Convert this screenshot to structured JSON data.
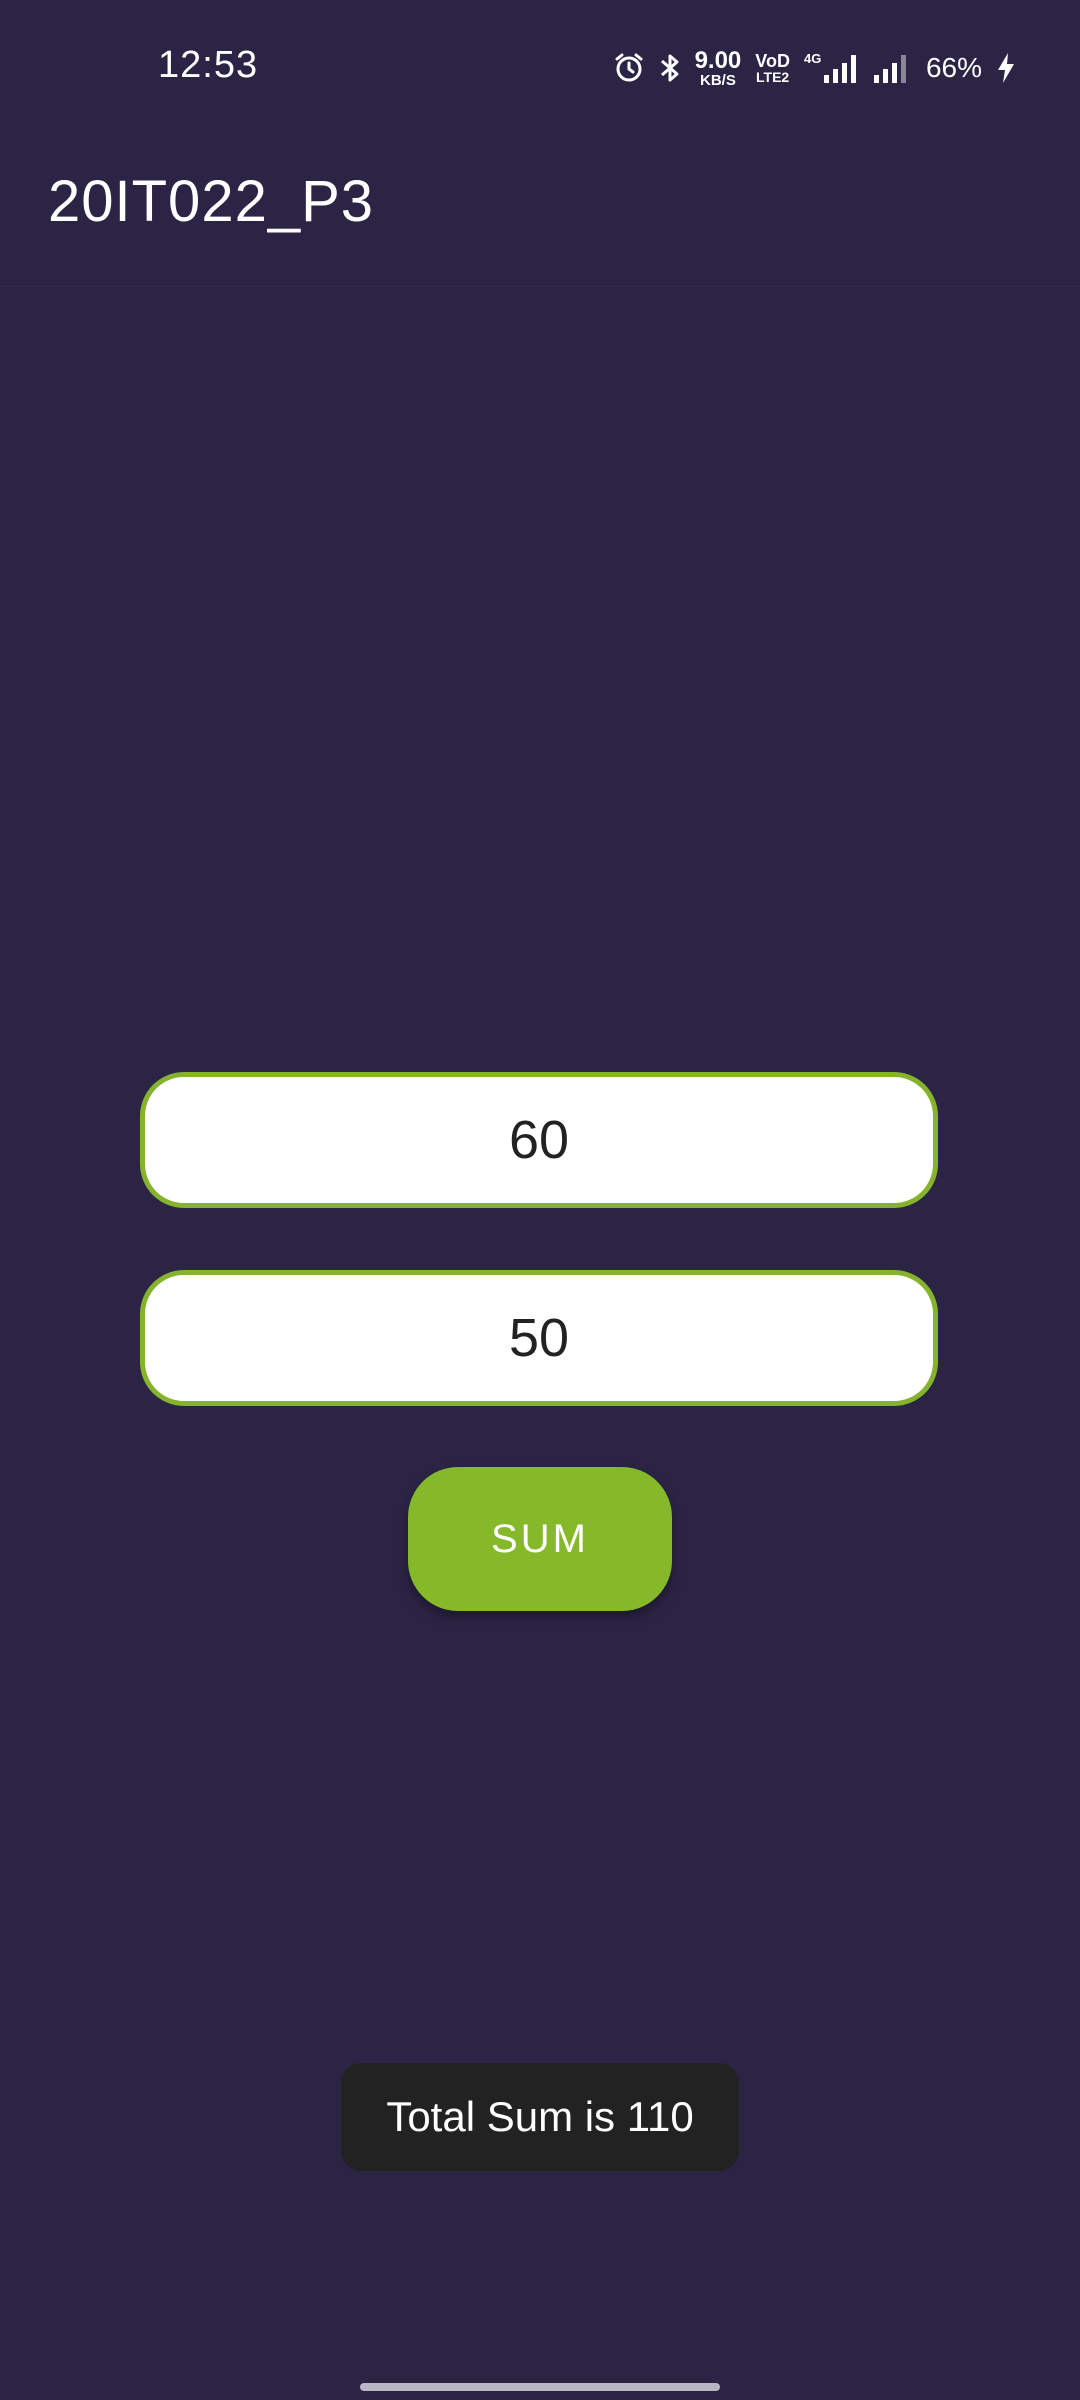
{
  "status_bar": {
    "time": "12:53",
    "icons": [
      "alarm-icon",
      "bluetooth-icon",
      "volte-icon",
      "4g-signal-icon",
      "signal-icon",
      "battery-charging-icon"
    ],
    "net_speed_value": "9.00",
    "net_speed_unit": "KB/S",
    "volte_top": "VoD",
    "volte_bottom": "LTE2",
    "network_type": "4G",
    "battery": "66%"
  },
  "app_bar": {
    "title": "20IT022_P3"
  },
  "form": {
    "first_value": "60",
    "second_value": "50",
    "sum_label": "SUM"
  },
  "toast": {
    "message": "Total Sum is 110"
  },
  "colors": {
    "background": "#2b2445",
    "accent": "#86b92a",
    "field_border": "#86b32d",
    "toast_bg": "#222222"
  }
}
